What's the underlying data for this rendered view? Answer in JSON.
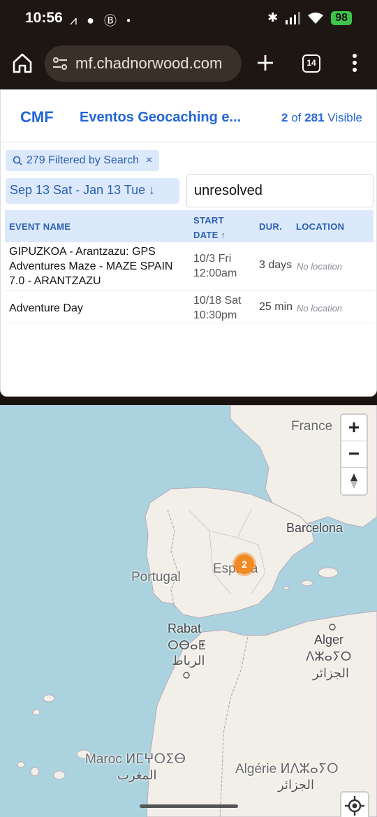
{
  "status_bar": {
    "time": "10:56",
    "battery": "98"
  },
  "browser": {
    "url": "mf.chadnorwood.com",
    "tab_count": "14"
  },
  "app": {
    "brand": "CMF",
    "title": "Eventos Geocaching e...",
    "visible": {
      "shown": "2",
      "of_label": "of",
      "total": "281",
      "suffix": "Visible"
    }
  },
  "filters": {
    "chip_label": "279 Filtered by Search",
    "chip_close": "×",
    "date_range": "Sep 13 Sat - Jan 13 Tue ↓",
    "search_value": "unresolved"
  },
  "table": {
    "headers": {
      "name": "EVENT NAME",
      "start_date_line1": "START",
      "start_date_line2": "DATE ↑",
      "duration": "DUR.",
      "location": "LOCATION"
    },
    "rows": [
      {
        "name": "GIPUZKOA - Arantzazu: GPS Adventures Maze - MAZE SPAIN 7.0 - ARANTZAZU",
        "date_line1": "10/3 Fri",
        "date_line2": "12:00am",
        "duration": "3 days",
        "location": "No location"
      },
      {
        "name": "Adventure Day",
        "date_line1": "10/18 Sat",
        "date_line2": "10:30pm",
        "duration": "25 min",
        "location": "No location"
      }
    ]
  },
  "map": {
    "labels": {
      "france": "France",
      "barcelona": "Barcelona",
      "portugal": "Portugal",
      "espana": "España",
      "rabat": "Rabat",
      "rabat_tifinagh": "ⵔⴱⴰⵟ",
      "rabat_arabic": "الرباط",
      "alger": "Alger",
      "alger_tifinagh": "ⴷⵣⴰⵢⵔ",
      "alger_arabic": "الجزائر",
      "maroc": "Maroc ⵍⵎⵖⵔⵉⴱ",
      "maroc_arabic": "المغرب",
      "algerie": "Algérie ⵍⴷⵣⴰⵢⵔ",
      "algerie_arabic": "الجزائر"
    },
    "zoom_in": "+",
    "zoom_out": "−",
    "cluster_count": "2",
    "colors": {
      "water": "#aad3df",
      "land": "#f2efe9",
      "cluster": "#f08a22"
    }
  }
}
